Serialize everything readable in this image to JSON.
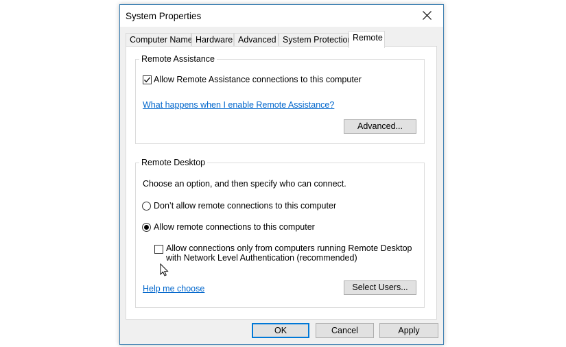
{
  "window": {
    "title": "System Properties"
  },
  "tabs": [
    {
      "label": "Computer Name"
    },
    {
      "label": "Hardware"
    },
    {
      "label": "Advanced"
    },
    {
      "label": "System Protection"
    },
    {
      "label": "Remote",
      "active": true
    }
  ],
  "remote_assistance": {
    "legend": "Remote Assistance",
    "allow_checkbox_label": "Allow Remote Assistance connections to this computer",
    "allow_checked": true,
    "help_link": "What happens when I enable Remote Assistance?",
    "advanced_button": "Advanced..."
  },
  "remote_desktop": {
    "legend": "Remote Desktop",
    "instruction": "Choose an option, and then specify who can connect.",
    "option_deny": "Don’t allow remote connections to this computer",
    "option_allow": "Allow remote connections to this computer",
    "selected_option": "allow",
    "nla_line1": "Allow connections only from computers running Remote Desktop",
    "nla_line2": "with Network Level Authentication (recommended)",
    "nla_checked": false,
    "help_link": "Help me choose",
    "select_users_button": "Select Users..."
  },
  "footer": {
    "ok": "OK",
    "cancel": "Cancel",
    "apply": "Apply"
  },
  "colors": {
    "accent": "#0078d7",
    "link": "#0066cc",
    "dialog_bg": "#f0f0f0"
  },
  "icons": {
    "close": "close-icon",
    "checkmark": "checkmark-icon",
    "cursor": "mouse-pointer-icon"
  }
}
